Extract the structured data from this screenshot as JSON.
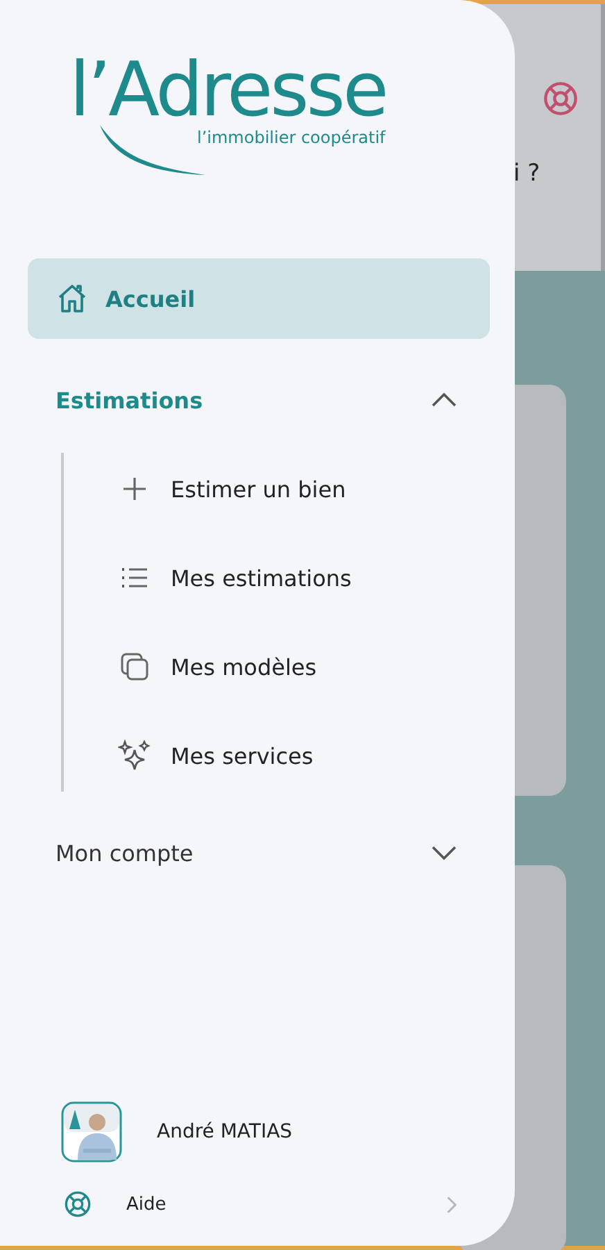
{
  "background": {
    "header_text": "i ?"
  },
  "logo": {
    "name": "l’Adresse",
    "tagline": "l’immobilier coopératif"
  },
  "menu": [
    {
      "kind": "link",
      "label": "Accueil",
      "selected": true
    },
    {
      "kind": "section",
      "label": "Estimations",
      "expanded": true,
      "children": [
        {
          "label": "Estimer un bien",
          "selected": false
        },
        {
          "label": "Mes estimations",
          "selected": false
        },
        {
          "label": "Mes modèles",
          "selected": false
        },
        {
          "label": "Mes services",
          "selected": false
        }
      ]
    },
    {
      "kind": "section",
      "label": "Mon compte",
      "expanded": false
    }
  ],
  "user": {
    "name": "André MATIAS"
  },
  "help": {
    "label": "Aide"
  }
}
